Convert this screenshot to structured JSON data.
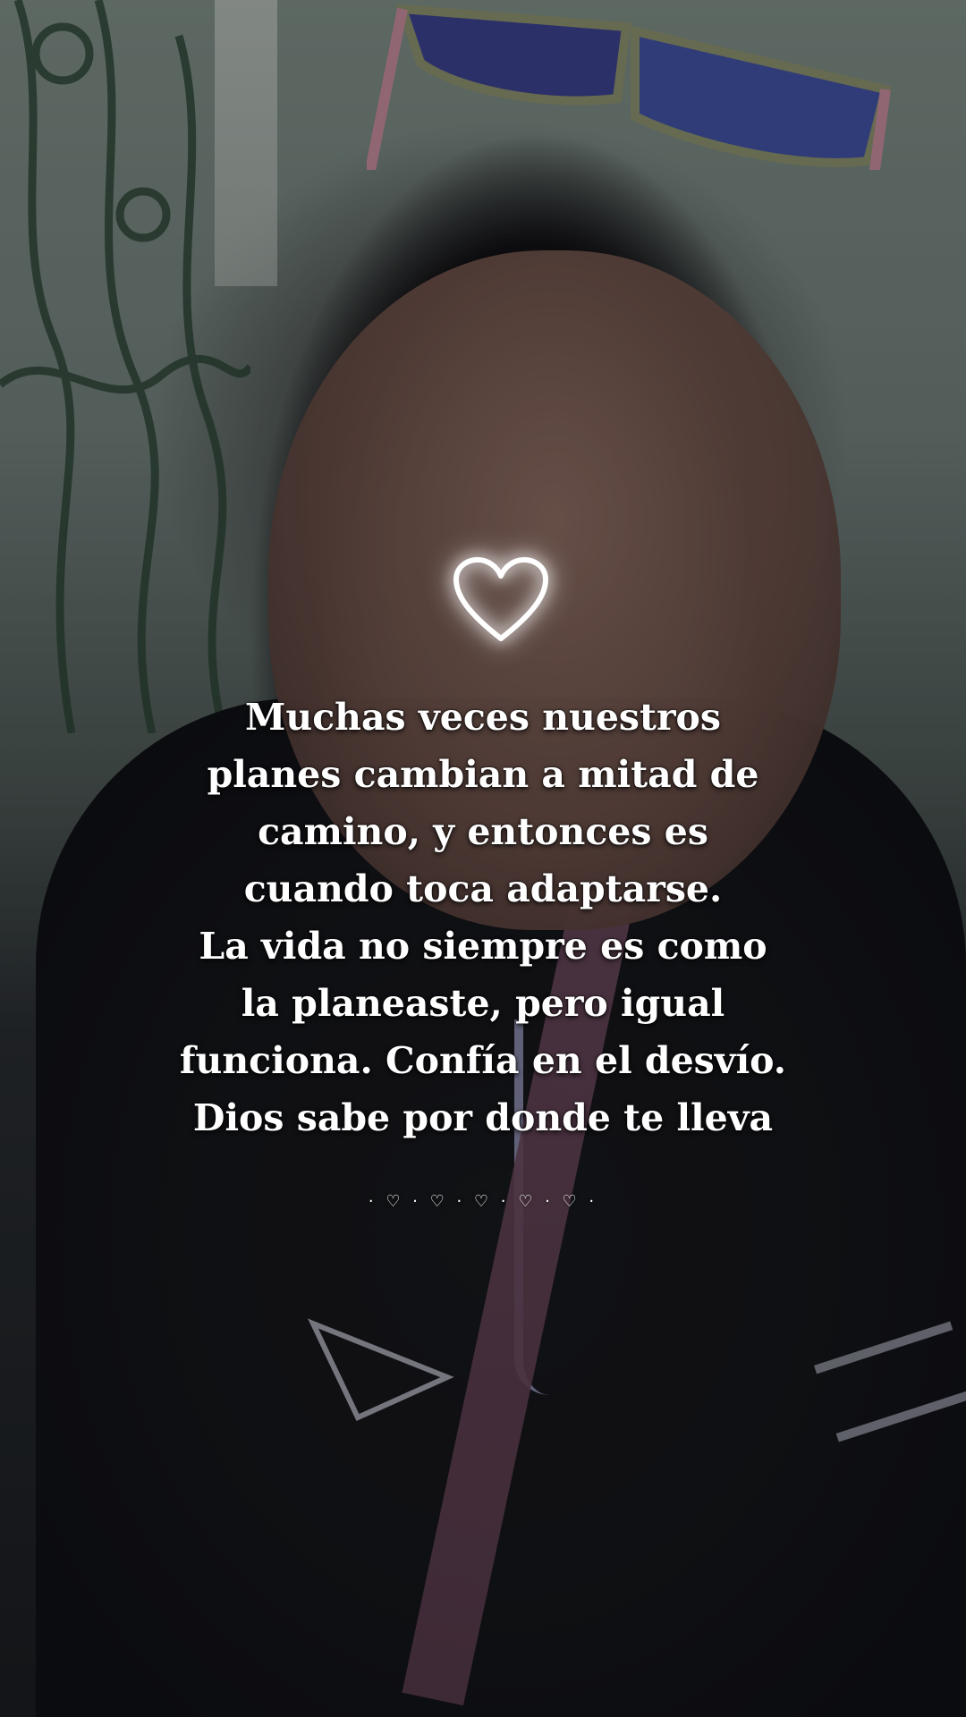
{
  "overlay": {
    "heart_icon": "glowing-heart-outline",
    "quote_lines": [
      "Muchas veces nuestros",
      "planes cambian a mitad de",
      "camino, y entonces es",
      "cuando toca adaptarse.",
      "La vida no siempre es como",
      "la planeaste, pero igual",
      "funciona. Confía en el desvío.",
      "Dios sabe por donde te lleva"
    ],
    "decorative_hearts": "· ♡ · ♡ · ♡ · ♡ · ♡ ·"
  },
  "colors": {
    "text": "#ffffff",
    "heart_glow": "#ffffff"
  }
}
